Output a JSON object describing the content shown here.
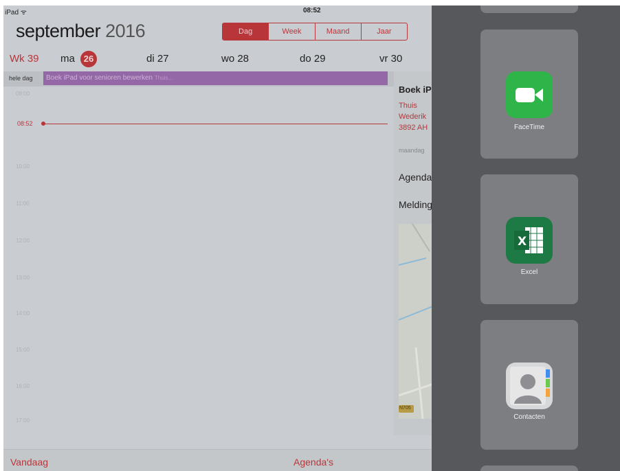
{
  "status": {
    "device": "iPad",
    "wifi_icon": "wifi-icon",
    "time": "08:52"
  },
  "calendar": {
    "month": "september",
    "year": "2016",
    "views": [
      "Dag",
      "Week",
      "Maand",
      "Jaar"
    ],
    "selected_view": "Dag",
    "week_label": "Wk 39",
    "days": [
      {
        "label": "ma",
        "num": "26"
      },
      {
        "label": "di 27"
      },
      {
        "label": "wo 28"
      },
      {
        "label": "do 29"
      },
      {
        "label": "vr 30"
      }
    ],
    "allday_label": "hele dag",
    "event_title": "Boek iPad voor senioren bewerken",
    "event_location_short": "Thuis...",
    "now_time": "08:52",
    "hours": [
      "08:00",
      "10:00",
      "11:00",
      "12:00",
      "13:00",
      "14:00",
      "15:00",
      "16:00",
      "17:00"
    ],
    "detail": {
      "title": "Boek iP",
      "loc1": "Thuis",
      "loc2": "Wederik",
      "loc3": "3892 AH",
      "date": "maandag",
      "agenda": "Agenda",
      "melding": "Melding",
      "road": "N705"
    },
    "bottom": {
      "today": "Vandaag",
      "calendars": "Agenda's"
    }
  },
  "switcher": {
    "apps": [
      {
        "name": "FaceTime",
        "icon": "facetime-icon"
      },
      {
        "name": "Excel",
        "icon": "excel-icon"
      },
      {
        "name": "Contacten",
        "icon": "contacts-icon"
      }
    ]
  },
  "colors": {
    "accent": "#b8353a",
    "event": "#9468a6",
    "switcher_bg": "#56585c"
  }
}
